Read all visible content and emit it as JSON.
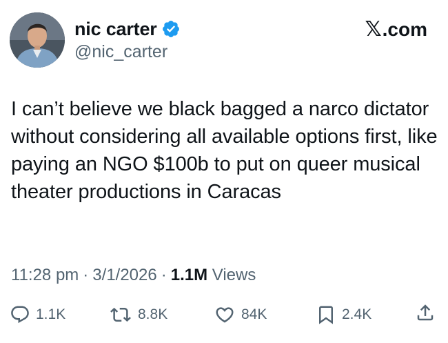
{
  "tweet": {
    "author": {
      "display_name": "nic carter",
      "handle": "@nic_carter",
      "verified": true,
      "avatar_icon": "profile-photo"
    },
    "brand": {
      "logo_letter": "𝕏",
      "domain": ".com"
    },
    "text": "I can’t believe we black bagged a narco dictator without considering all available options first, like paying an NGO $100b to put on queer musical theater productions in Caracas",
    "meta": {
      "time": "11:28 pm",
      "separator": "·",
      "date": "3/1/2026",
      "views_count": "1.1M",
      "views_label": "Views"
    },
    "actions": {
      "replies": "1.1K",
      "reposts": "8.8K",
      "likes": "84K",
      "bookmarks": "2.4K"
    }
  },
  "colors": {
    "text_primary": "#0f1419",
    "text_secondary": "#536471",
    "verified_blue": "#1d9bf0",
    "background": "#ffffff"
  },
  "icons": [
    "verified-badge-icon",
    "reply-icon",
    "repost-icon",
    "like-icon",
    "bookmark-icon",
    "share-icon"
  ]
}
